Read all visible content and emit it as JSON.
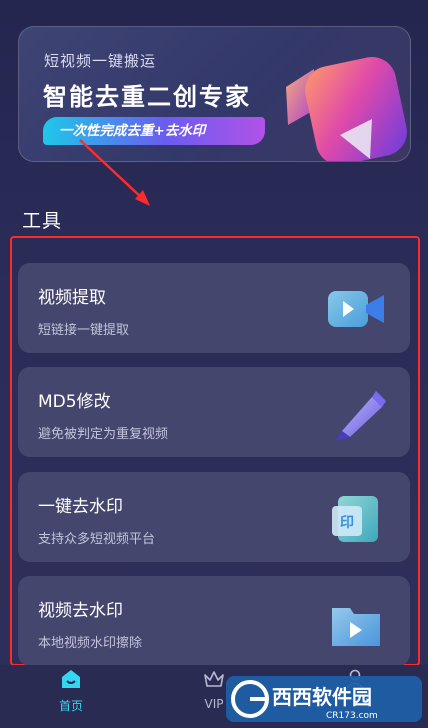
{
  "banner": {
    "subtitle": "短视频一键搬运",
    "title": "智能去重二创专家",
    "pill": "一次性完成去重+去水印"
  },
  "section": {
    "title": "工具"
  },
  "tools": [
    {
      "title": "视频提取",
      "desc": "短链接一键提取",
      "icon": "video-camera-icon"
    },
    {
      "title": "MD5修改",
      "desc": "避免被判定为重复视频",
      "icon": "pen-icon"
    },
    {
      "title": "一键去水印",
      "desc": "支持众多短视频平台",
      "icon": "watermark-seal-icon"
    },
    {
      "title": "视频去水印",
      "desc": "本地视频水印擦除",
      "icon": "folder-play-icon"
    }
  ],
  "nav": {
    "home": "首页",
    "vip": "VIP"
  },
  "watermark": {
    "brand": "西西软件园",
    "domain": "CR173.com"
  },
  "colors": {
    "accent": "#35d6f0",
    "annotation": "#ff2a2a",
    "card": "#45466e"
  }
}
